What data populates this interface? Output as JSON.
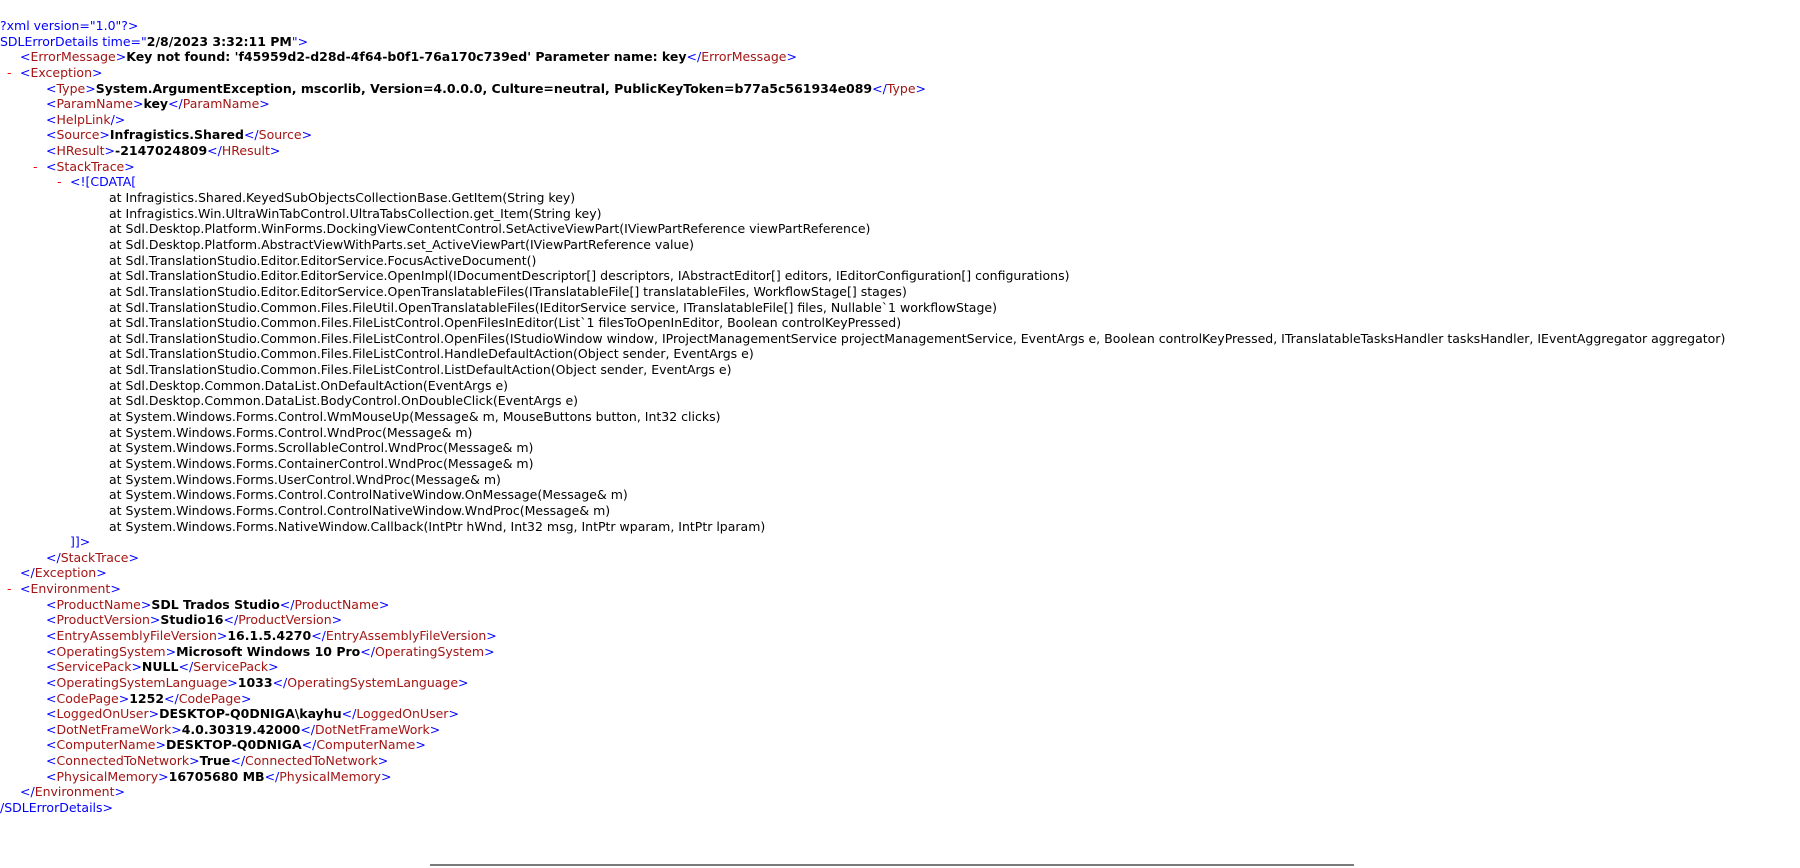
{
  "declaration": "?xml version=\"1.0\"?>",
  "root": {
    "open_prefix": "SDLErrorDetails time=\"",
    "time_value": "2/8/2023 3:32:11 PM",
    "open_suffix": "\">",
    "close": "/SDLErrorDetails>"
  },
  "error_message": {
    "value": "Key not found: 'f45959d2-d28d-4f64-b0f1-76a170c739ed' Parameter name: key"
  },
  "exception": {
    "type": "System.ArgumentException, mscorlib, Version=4.0.0.0, Culture=neutral, PublicKeyToken=b77a5c561934e089",
    "param_name": "key",
    "source": "Infragistics.Shared",
    "hresult": "-2147024809",
    "cdata_open": "<![CDATA[",
    "cdata_close": "]]>",
    "stack_trace": [
      "at Infragistics.Shared.KeyedSubObjectsCollectionBase.GetItem(String key)",
      "at Infragistics.Win.UltraWinTabControl.UltraTabsCollection.get_Item(String key)",
      "at Sdl.Desktop.Platform.WinForms.DockingViewContentControl.SetActiveViewPart(IViewPartReference viewPartReference)",
      "at Sdl.Desktop.Platform.AbstractViewWithParts.set_ActiveViewPart(IViewPartReference value)",
      "at Sdl.TranslationStudio.Editor.EditorService.FocusActiveDocument()",
      "at Sdl.TranslationStudio.Editor.EditorService.OpenImpl(IDocumentDescriptor[] descriptors, IAbstractEditor[] editors, IEditorConfiguration[] configurations)",
      "at Sdl.TranslationStudio.Editor.EditorService.OpenTranslatableFiles(ITranslatableFile[] translatableFiles, WorkflowStage[] stages)",
      "at Sdl.TranslationStudio.Common.Files.FileUtil.OpenTranslatableFiles(IEditorService service, ITranslatableFile[] files, Nullable`1 workflowStage)",
      "at Sdl.TranslationStudio.Common.Files.FileListControl.OpenFilesInEditor(List`1 filesToOpenInEditor, Boolean controlKeyPressed)",
      "at Sdl.TranslationStudio.Common.Files.FileListControl.OpenFiles(IStudioWindow window, IProjectManagementService projectManagementService, EventArgs e, Boolean controlKeyPressed, ITranslatableTasksHandler tasksHandler, IEventAggregator aggregator)",
      "at Sdl.TranslationStudio.Common.Files.FileListControl.HandleDefaultAction(Object sender, EventArgs e)",
      "at Sdl.TranslationStudio.Common.Files.FileListControl.ListDefaultAction(Object sender, EventArgs e)",
      "at Sdl.Desktop.Common.DataList.OnDefaultAction(EventArgs e)",
      "at Sdl.Desktop.Common.DataList.BodyControl.OnDoubleClick(EventArgs e)",
      "at System.Windows.Forms.Control.WmMouseUp(Message& m, MouseButtons button, Int32 clicks)",
      "at System.Windows.Forms.Control.WndProc(Message& m)",
      "at System.Windows.Forms.ScrollableControl.WndProc(Message& m)",
      "at System.Windows.Forms.ContainerControl.WndProc(Message& m)",
      "at System.Windows.Forms.UserControl.WndProc(Message& m)",
      "at System.Windows.Forms.Control.ControlNativeWindow.OnMessage(Message& m)",
      "at System.Windows.Forms.Control.ControlNativeWindow.WndProc(Message& m)",
      "at System.Windows.Forms.NativeWindow.Callback(IntPtr hWnd, Int32 msg, IntPtr wparam, IntPtr lparam)"
    ]
  },
  "environment": {
    "product_name": "SDL Trados Studio",
    "product_version": "Studio16",
    "entry_assembly_file_version": "16.1.5.4270",
    "operating_system": "Microsoft Windows 10 Pro",
    "service_pack": "NULL",
    "operating_system_language": "1033",
    "code_page": "1252",
    "logged_on_user": "DESKTOP-Q0DNIGA\\kayhu",
    "dot_net_frame_work": "4.0.30319.42000",
    "computer_name": "DESKTOP-Q0DNIGA",
    "connected_to_network": "True",
    "physical_memory": "16705680 MB"
  },
  "tags": {
    "error_message": "ErrorMessage",
    "exception": "Exception",
    "type": "Type",
    "param_name": "ParamName",
    "help_link": "HelpLink",
    "source": "Source",
    "hresult": "HResult",
    "stack_trace": "StackTrace",
    "environment": "Environment",
    "product_name": "ProductName",
    "product_version": "ProductVersion",
    "entry_assembly_file_version": "EntryAssemblyFileVersion",
    "operating_system": "OperatingSystem",
    "service_pack": "ServicePack",
    "operating_system_language": "OperatingSystemLanguage",
    "code_page": "CodePage",
    "logged_on_user": "LoggedOnUser",
    "dot_net_frame_work": "DotNetFrameWork",
    "computer_name": "ComputerName",
    "connected_to_network": "ConnectedToNetwork",
    "physical_memory": "PhysicalMemory"
  },
  "toggle_symbol": "-",
  "colors": {
    "bracket": "#0000ff",
    "tag_name": "#a31515",
    "toggle": "#ff0000"
  }
}
